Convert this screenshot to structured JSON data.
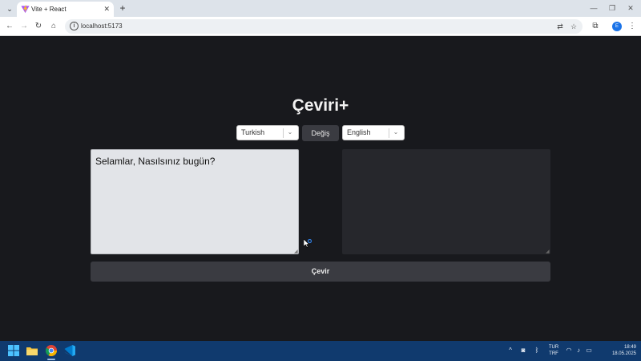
{
  "browser": {
    "tab_title": "Vite + React",
    "tab_close": "✕",
    "new_tab": "+",
    "url": "localhost:5173",
    "profile_initial": "E",
    "icons": [
      "tab-search-icon",
      "vite-logo-icon",
      "back-icon",
      "forward-icon",
      "reload-icon",
      "home-icon",
      "site-info-icon",
      "translate-icon",
      "bookmark-star-icon",
      "extensions-icon",
      "menu-icon",
      "minimize-icon",
      "restore-icon",
      "close-window-icon"
    ]
  },
  "app": {
    "title": "Çeviri+",
    "source_language": "Turkish",
    "target_language": "English",
    "swap_label": "Değiş",
    "source_text": "Selamlar, Nasılsınız bugün?",
    "target_text": "",
    "translate_label": "Çevir"
  },
  "taskbar": {
    "apps": [
      "windows-start-icon",
      "file-explorer-icon",
      "chrome-icon",
      "vscode-icon"
    ],
    "tray_icons": [
      "chevron-up-icon",
      "notification-icon",
      "bluetooth-icon",
      "wifi-icon",
      "volume-icon",
      "battery-icon"
    ],
    "language_line1": "TUR",
    "language_line2": "TRF",
    "time": "18:49",
    "date": "18.05.2025"
  },
  "colors": {
    "page_background": "#18191d",
    "button_background": "#3a3b41",
    "source_box_background": "#e2e4e8",
    "target_box_background": "#26272c",
    "taskbar": "#103a6e"
  }
}
